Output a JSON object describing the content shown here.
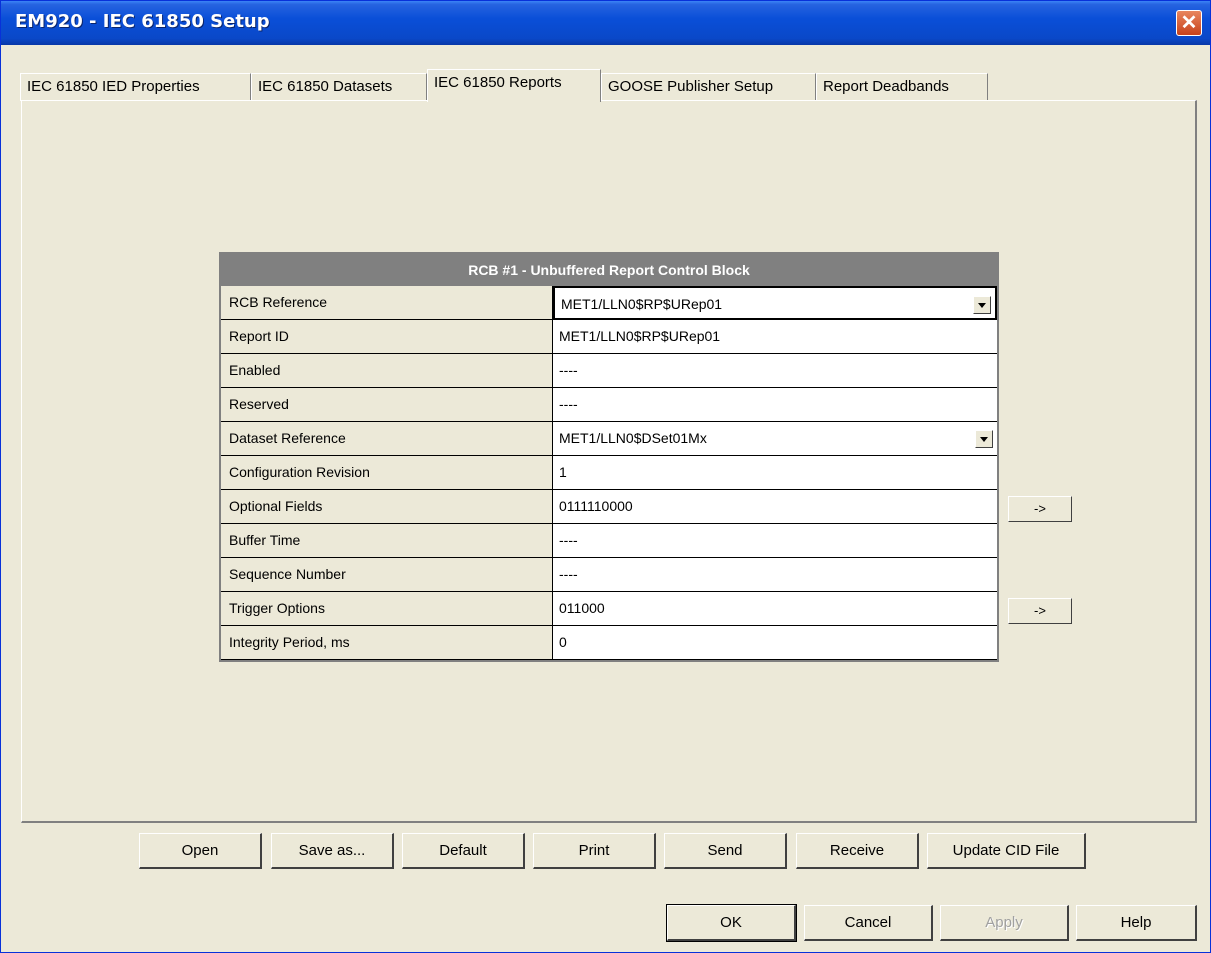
{
  "window": {
    "title": "EM920 - IEC 61850 Setup",
    "close_glyph": "✕"
  },
  "tabs": [
    {
      "label": "IEC 61850 IED Properties"
    },
    {
      "label": "IEC 61850 Datasets"
    },
    {
      "label": "IEC 61850 Reports"
    },
    {
      "label": "GOOSE Publisher Setup"
    },
    {
      "label": "Report Deadbands"
    }
  ],
  "grid": {
    "header": "RCB #1 - Unbuffered Report Control Block",
    "rows": [
      {
        "label": "RCB Reference",
        "value": "MET1/LLN0$RP$URep01"
      },
      {
        "label": "Report ID",
        "value": "MET1/LLN0$RP$URep01"
      },
      {
        "label": "Enabled",
        "value": "----"
      },
      {
        "label": "Reserved",
        "value": "----"
      },
      {
        "label": "Dataset Reference",
        "value": "MET1/LLN0$DSet01Mx"
      },
      {
        "label": "Configuration Revision",
        "value": "1"
      },
      {
        "label": "Optional Fields",
        "value": "0111110000"
      },
      {
        "label": "Buffer Time",
        "value": "----"
      },
      {
        "label": "Sequence Number",
        "value": "----"
      },
      {
        "label": "Trigger Options",
        "value": "011000"
      },
      {
        "label": "Integrity Period, ms",
        "value": "0"
      }
    ]
  },
  "side_buttons": {
    "optional_fields": "->",
    "trigger_options": "->"
  },
  "action_buttons": [
    "Open",
    "Save as...",
    "Default",
    "Print",
    "Send",
    "Receive",
    "Update CID File"
  ],
  "dialog_buttons": {
    "ok": "OK",
    "cancel": "Cancel",
    "apply": "Apply",
    "help": "Help"
  }
}
